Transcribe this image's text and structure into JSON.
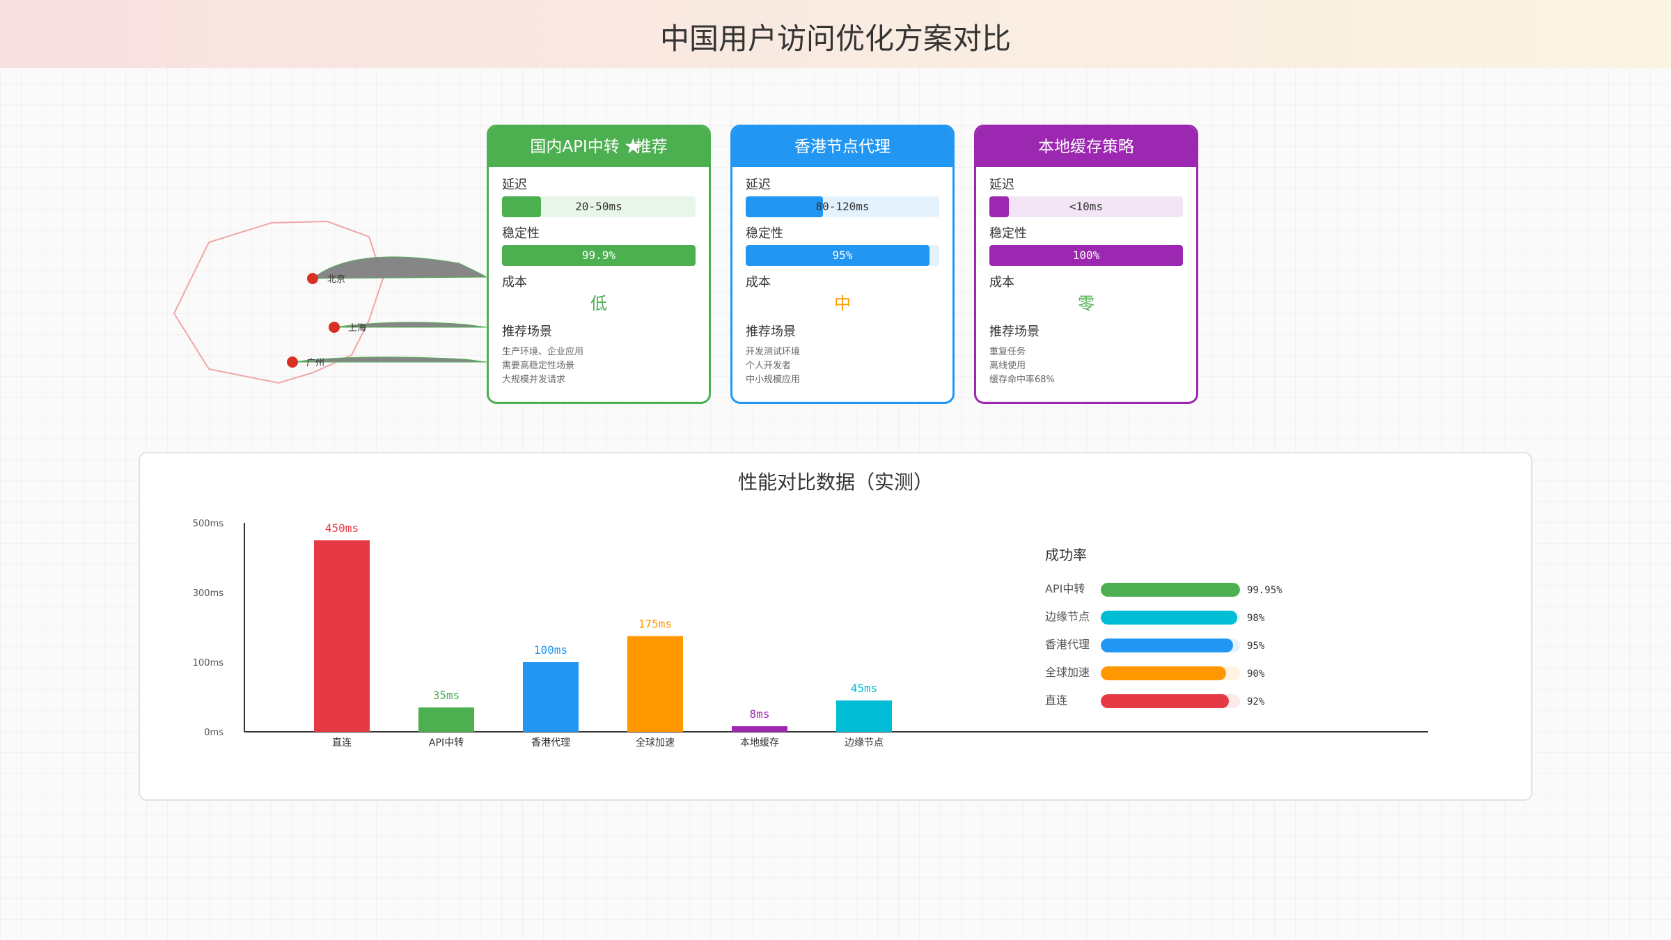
{
  "header": {
    "title": "中国用户访问优化方案对比"
  },
  "map": {
    "cities": [
      {
        "id": "beijing",
        "label": "北京"
      },
      {
        "id": "shanghai",
        "label": "上海"
      },
      {
        "id": "guangzhou",
        "label": "广州"
      }
    ],
    "outline_color": "#f0a6a6",
    "dot_color": "#d93025",
    "link_color": "#808080"
  },
  "cards": [
    {
      "id": "api-relay",
      "title": "国内API中转",
      "star_icon": "star-icon",
      "title_suffix": "推荐",
      "color": "#4caf50",
      "track_color": "#e8f5e9",
      "latency_label": "延迟",
      "latency_value": "20-50ms",
      "latency_fill": 0.2,
      "stability_label": "稳定性",
      "stability_value": "99.9%",
      "stability_fill": 0.999,
      "cost_label": "成本",
      "cost_value": "低",
      "cost_color": "#4caf50",
      "scenario_label": "推荐场景",
      "scenarios": [
        "生产环境、企业应用",
        "需要高稳定性场景",
        "大规模并发请求"
      ]
    },
    {
      "id": "hk-proxy",
      "title": "香港节点代理",
      "star_icon": "",
      "title_suffix": "",
      "color": "#2196f3",
      "track_color": "#e3f2fd",
      "latency_label": "延迟",
      "latency_value": "80-120ms",
      "latency_fill": 0.4,
      "stability_label": "稳定性",
      "stability_value": "95%",
      "stability_fill": 0.95,
      "cost_label": "成本",
      "cost_value": "中",
      "cost_color": "#ff9800",
      "scenario_label": "推荐场景",
      "scenarios": [
        "开发测试环境",
        "个人开发者",
        "中小规模应用"
      ]
    },
    {
      "id": "local-cache",
      "title": "本地缓存策略",
      "star_icon": "",
      "title_suffix": "",
      "color": "#9c27b0",
      "track_color": "#f3e5f5",
      "latency_label": "延迟",
      "latency_value": "<10ms",
      "latency_fill": 0.1,
      "stability_label": "稳定性",
      "stability_value": "100%",
      "stability_fill": 1.0,
      "cost_label": "成本",
      "cost_value": "零",
      "cost_color": "#4caf50",
      "scenario_label": "推荐场景",
      "scenarios": [
        "重复任务",
        "离线使用",
        "缓存命中率68%"
      ]
    }
  ],
  "performance": {
    "title": "性能对比数据（实测）"
  },
  "chart_data": [
    {
      "type": "bar",
      "title": "",
      "xlabel": "",
      "ylabel": "",
      "categories": [
        "直连",
        "API中转",
        "香港代理",
        "全球加速",
        "本地缓存",
        "边缘节点"
      ],
      "values": [
        450,
        35,
        100,
        175,
        8,
        45
      ],
      "value_labels": [
        "450ms",
        "35ms",
        "100ms",
        "175ms",
        "8ms",
        "45ms"
      ],
      "colors": [
        "#e63946",
        "#4caf50",
        "#2196f3",
        "#ff9800",
        "#9c27b0",
        "#00bcd4"
      ],
      "y_ticks": [
        {
          "value": 0,
          "label": "0ms"
        },
        {
          "value": 100,
          "label": "100ms"
        },
        {
          "value": 300,
          "label": "300ms"
        },
        {
          "value": 500,
          "label": "500ms"
        }
      ],
      "grid": false
    },
    {
      "type": "bar",
      "orientation": "horizontal",
      "title": "成功率",
      "categories": [
        "API中转",
        "边缘节点",
        "香港代理",
        "全球加速",
        "直连"
      ],
      "values": [
        99.95,
        98,
        95,
        90,
        92
      ],
      "value_labels": [
        "99.95%",
        "98%",
        "95%",
        "90%",
        "92%"
      ],
      "colors": [
        "#4caf50",
        "#00bcd4",
        "#2196f3",
        "#ff9800",
        "#e63946"
      ],
      "track_colors": [
        "#e8f5e9",
        "#e0f7fa",
        "#e3f2fd",
        "#fff3e0",
        "#fde8ea"
      ],
      "xlim": [
        0,
        100
      ]
    }
  ]
}
